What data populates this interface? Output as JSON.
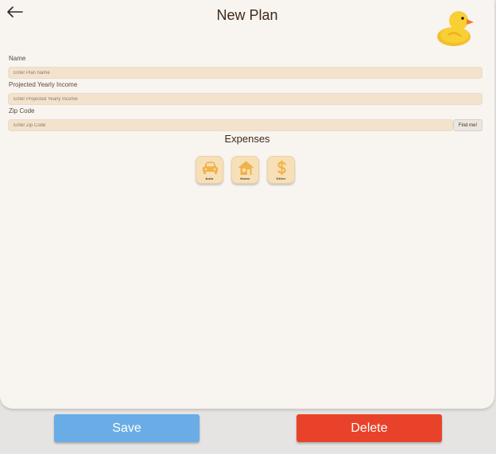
{
  "header": {
    "title": "New Plan",
    "back_icon": "arrow-left-icon",
    "mascot_icon": "rubber-duck-icon"
  },
  "form": {
    "name": {
      "label": "Name",
      "placeholder": "Enter Plan Name",
      "value": ""
    },
    "income": {
      "label": "Projected Yearly Income",
      "placeholder": "Enter Projected Yearly Income",
      "value": ""
    },
    "zip": {
      "label": "Zip Code",
      "placeholder": "Enter Zip Code",
      "value": "",
      "find_label": "Find me!"
    }
  },
  "expenses": {
    "title": "Expenses",
    "items": [
      {
        "label": "Auto",
        "icon": "car-icon"
      },
      {
        "label": "Home",
        "icon": "house-icon"
      },
      {
        "label": "Other",
        "icon": "dollar-icon"
      }
    ]
  },
  "actions": {
    "save_label": "Save",
    "delete_label": "Delete"
  },
  "colors": {
    "background": "#f8f4f0",
    "input_fill": "#f3e3cc",
    "icon_accent": "#f0b24a",
    "save": "#6aade6",
    "delete": "#e8432a"
  }
}
